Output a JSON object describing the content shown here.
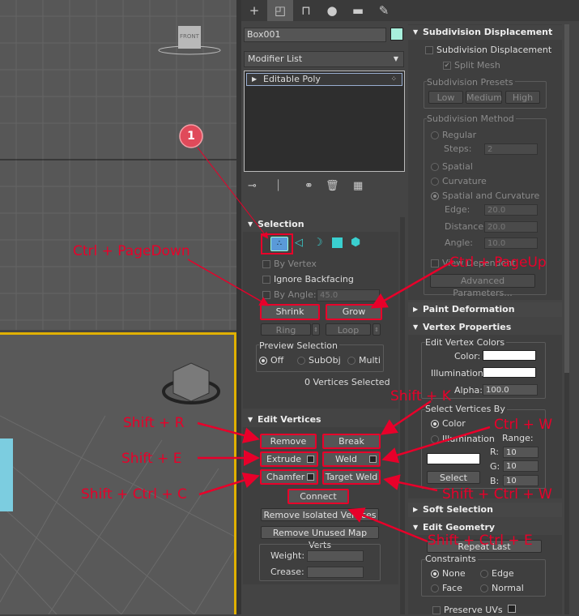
{
  "tabs": [
    {
      "icon": "plus-icon"
    },
    {
      "icon": "modify-icon"
    },
    {
      "icon": "hierarchy-icon"
    },
    {
      "icon": "motion-icon"
    },
    {
      "icon": "display-icon"
    },
    {
      "icon": "utilities-icon"
    }
  ],
  "viewcube_label": "FRONT",
  "object_name": "Box001",
  "object_color": "#a8f0dc",
  "modifier_list": "Modifier List",
  "stack_item": "Editable Poly",
  "selection": {
    "title": "Selection",
    "by_vertex": "By Vertex",
    "ignore_backfacing": "Ignore Backfacing",
    "by_angle": "By Angle:",
    "angle_val": "45.0",
    "shrink": "Shrink",
    "grow": "Grow",
    "ring": "Ring",
    "loop": "Loop",
    "preview_title": "Preview Selection",
    "off": "Off",
    "subobj": "SubObj",
    "multi": "Multi",
    "status": "0 Vertices Selected"
  },
  "edit_vertices": {
    "title": "Edit Vertices",
    "remove": "Remove",
    "break": "Break",
    "extrude": "Extrude",
    "weld": "Weld",
    "chamfer": "Chamfer",
    "target_weld": "Target Weld",
    "connect": "Connect",
    "remove_isolated": "Remove Isolated Vertices",
    "remove_unused": "Remove Unused Map Verts",
    "weight": "Weight:",
    "crease": "Crease:"
  },
  "subdiv": {
    "title": "Subdivision Displacement",
    "enable": "Subdivision Displacement",
    "split_mesh": "Split Mesh",
    "presets_title": "Subdivision Presets",
    "low": "Low",
    "medium": "Medium",
    "high": "High",
    "method_title": "Subdivision Method",
    "regular": "Regular",
    "steps": "Steps:",
    "steps_val": "2",
    "spatial": "Spatial",
    "curvature": "Curvature",
    "spatial_curv": "Spatial and Curvature",
    "edge": "Edge:",
    "edge_val": "20.0",
    "distance": "Distance:",
    "distance_val": "20.0",
    "angle": "Angle:",
    "angle_val": "10.0",
    "view_dependent": "View Dependent",
    "advanced": "Advanced Parameters..."
  },
  "paint_deformation": "Paint Deformation",
  "vertex_props": {
    "title": "Vertex Properties",
    "colors_title": "Edit Vertex Colors",
    "color": "Color:",
    "illumination": "Illumination:",
    "alpha": "Alpha:",
    "alpha_val": "100.0",
    "select_by": "Select Vertices By",
    "sel_color": "Color",
    "sel_illum": "Illumination",
    "range": "Range:",
    "r": "R:",
    "g": "G:",
    "b": "B:",
    "r_val": "10",
    "g_val": "10",
    "b_val": "10",
    "select": "Select"
  },
  "soft_selection": "Soft Selection",
  "edit_geometry": {
    "title": "Edit Geometry",
    "repeat_last": "Repeat Last",
    "constraints": "Constraints",
    "none": "None",
    "edge": "Edge",
    "face": "Face",
    "normal": "Normal",
    "preserve_uvs": "Preserve UVs"
  },
  "annotations": {
    "marker": "1",
    "ctrl_pagedown": "Ctrl + PageDown",
    "ctrl_pageup": "Ctrl + PageUp",
    "shift_r": "Shift + R",
    "shift_e": "Shift + E",
    "shift_ctrl_c": "Shift + Ctrl + C",
    "shift_k": "Shift + K",
    "ctrl_w": "Ctrl + W",
    "shift_ctrl_w": "Shift + Ctrl + W",
    "shift_ctrl_e": "Shift + Ctrl + E"
  }
}
